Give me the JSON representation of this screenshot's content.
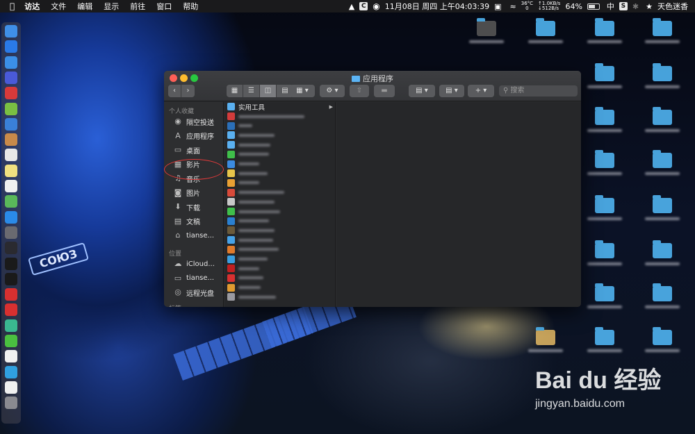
{
  "menubar": {
    "apple": "",
    "app_name": "访达",
    "menus": [
      "文件",
      "编辑",
      "显示",
      "前往",
      "窗口",
      "帮助"
    ],
    "status": {
      "c_icon": "C",
      "datetime": "11月08日 周四 上午04:03:39",
      "temp_top": "36°C",
      "temp_bottom": "0",
      "net_up": "↑1.0KB/s",
      "net_down": "↓512B/s",
      "battery": "64%",
      "battery_level": 0.64,
      "input_method": "中",
      "s_icon": "S",
      "user": "天色迷香"
    }
  },
  "finder": {
    "title": "应用程序",
    "search_placeholder": "搜索",
    "sidebar": {
      "favorites_header": "个人收藏",
      "favorites": [
        {
          "label": "隔空投送",
          "icon": "airdrop-icon",
          "glyph": "◉"
        },
        {
          "label": "应用程序",
          "icon": "applications-icon",
          "glyph": "A"
        },
        {
          "label": "桌面",
          "icon": "desktop-icon",
          "glyph": "▭"
        },
        {
          "label": "影片",
          "icon": "movies-icon",
          "glyph": "▦"
        },
        {
          "label": "音乐",
          "icon": "music-icon",
          "glyph": "♫"
        },
        {
          "label": "图片",
          "icon": "pictures-icon",
          "glyph": "◙"
        },
        {
          "label": "下载",
          "icon": "downloads-icon",
          "glyph": "⬇"
        },
        {
          "label": "文稿",
          "icon": "documents-icon",
          "glyph": "▤"
        },
        {
          "label": "tianse...",
          "icon": "home-icon",
          "glyph": "⌂"
        }
      ],
      "locations_header": "位置",
      "locations": [
        {
          "label": "iCloud...",
          "icon": "icloud-icon",
          "glyph": "☁"
        },
        {
          "label": "tianse...",
          "icon": "computer-icon",
          "glyph": "▭"
        },
        {
          "label": "远程光盘",
          "icon": "remote-disc-icon",
          "glyph": "◎"
        }
      ],
      "tags_header": "标签"
    },
    "column1": {
      "first_item": "实用工具",
      "first_arrow": "▶",
      "icon_colors": [
        "#5ab0f0",
        "#d23b3b",
        "#2b6fb8",
        "#5ab0f0",
        "#5ab0f0",
        "#3fbf4a",
        "#3b8be0",
        "#e8c54a",
        "#e9a033",
        "#d84a3a",
        "#c8c8c8",
        "#3fbf4a",
        "#2a80d0",
        "#6b5a3a",
        "#47a3e8",
        "#e07a2a",
        "#3a9fe0",
        "#c02020",
        "#d83030",
        "#e09a30",
        "#9a9aa0"
      ]
    }
  },
  "dock": {
    "icon_colors": [
      "#3f8fe8",
      "#2a7ae8",
      "#3b8fe8",
      "#4a5ad8",
      "#d83a3a",
      "#7ac043",
      "#3a80d8",
      "#c88a4a",
      "#e8e8e8",
      "#f0e080",
      "#f0f0f0",
      "#5ab85a",
      "#2a8ae8",
      "#6a6a70",
      "#2a2a30",
      "#1a1a1a",
      "#1a1a1a",
      "#d83030",
      "#d83030",
      "#3ab890",
      "#4ac040",
      "#f0f0f0",
      "#30a0e0",
      "#f0f0f0",
      "#8a8a90"
    ]
  },
  "watermark": {
    "brand": "Bai du 经验",
    "url": "jingyan.baidu.com"
  }
}
